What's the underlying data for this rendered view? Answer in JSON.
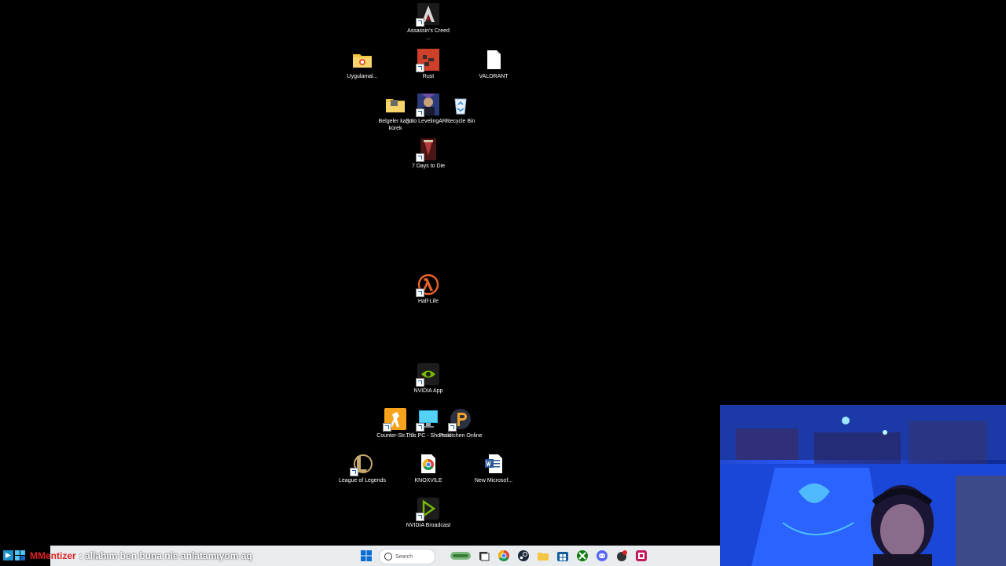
{
  "desktop": {
    "icons": [
      {
        "label": "Assassin's Creed ...",
        "icon": "assassins-creed-icon"
      },
      {
        "label": "Uygulamal...",
        "icon": "folder-icon"
      },
      {
        "label": "Rust",
        "icon": "rust-icon"
      },
      {
        "label": "VALORANT",
        "icon": "blank-file-icon"
      },
      {
        "label": "Belgeler kağıt kürek",
        "icon": "folder-icon"
      },
      {
        "label": "Solo LevelingAR...",
        "icon": "solo-leveling-icon"
      },
      {
        "label": "Recycle Bin",
        "icon": "recycle-bin-icon"
      },
      {
        "label": "7 Days to Die",
        "icon": "seven-days-to-die-icon"
      },
      {
        "label": "Half-Life",
        "icon": "half-life-icon"
      },
      {
        "label": "NVIDIA App",
        "icon": "nvidia-icon"
      },
      {
        "label": "Counter-Str... 2",
        "icon": "counter-strike-icon"
      },
      {
        "label": "This PC - Shortcut",
        "icon": "this-pc-icon"
      },
      {
        "label": "Prokitchen Online",
        "icon": "prokitchen-icon"
      },
      {
        "label": "League of Legends",
        "icon": "league-of-legends-icon"
      },
      {
        "label": "KNOXVILE",
        "icon": "chrome-icon"
      },
      {
        "label": "New Microsof...",
        "icon": "word-document-icon"
      },
      {
        "label": "NVIDIA Broadcast",
        "icon": "nvidia-broadcast-icon"
      }
    ]
  },
  "taskbar": {
    "search_placeholder": "Search",
    "apps": [
      "windows-start-icon",
      "search-icon",
      "widget-icon",
      "task-view-icon",
      "chrome-icon",
      "steam-icon",
      "file-explorer-icon",
      "store-icon",
      "xbox-icon",
      "discord-icon",
      "app-icon",
      "app-icon"
    ]
  },
  "chat": {
    "username": "MMentizer",
    "message": ": allahım ben buna nie anlatamıyom aq"
  },
  "colors": {
    "desktop_bg": "#000000",
    "taskbar_bg": "#e9ecef",
    "chat_user": "#e02020",
    "webcam_blue": "#2a5cff"
  }
}
